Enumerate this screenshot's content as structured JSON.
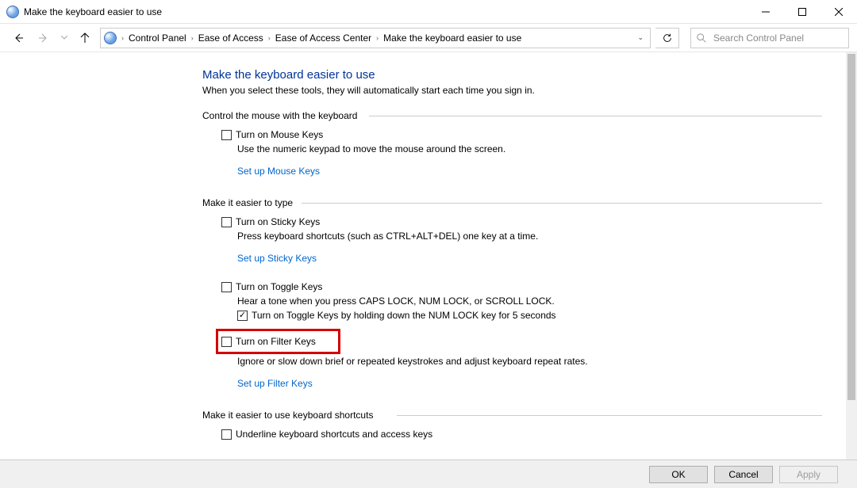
{
  "window": {
    "title": "Make the keyboard easier to use"
  },
  "breadcrumb": {
    "items": [
      "Control Panel",
      "Ease of Access",
      "Ease of Access Center",
      "Make the keyboard easier to use"
    ]
  },
  "search": {
    "placeholder": "Search Control Panel"
  },
  "page": {
    "heading": "Make the keyboard easier to use",
    "subheading": "When you select these tools, they will automatically start each time you sign in."
  },
  "sections": {
    "mouse": {
      "title": "Control the mouse with the keyboard",
      "mouse_keys_label": "Turn on Mouse Keys",
      "mouse_keys_desc": "Use the numeric keypad to move the mouse around the screen.",
      "setup_link": "Set up Mouse Keys"
    },
    "type": {
      "title": "Make it easier to type",
      "sticky_label": "Turn on Sticky Keys",
      "sticky_desc": "Press keyboard shortcuts (such as CTRL+ALT+DEL) one key at a time.",
      "sticky_link": "Set up Sticky Keys",
      "toggle_label": "Turn on Toggle Keys",
      "toggle_desc": "Hear a tone when you press CAPS LOCK, NUM LOCK, or SCROLL LOCK.",
      "toggle_hold_label": "Turn on Toggle Keys by holding down the NUM LOCK key for 5 seconds",
      "filter_label": "Turn on Filter Keys",
      "filter_desc": "Ignore or slow down brief or repeated keystrokes and adjust keyboard repeat rates.",
      "filter_link": "Set up Filter Keys"
    },
    "shortcuts": {
      "title": "Make it easier to use keyboard shortcuts",
      "underline_label": "Underline keyboard shortcuts and access keys"
    }
  },
  "buttons": {
    "ok": "OK",
    "cancel": "Cancel",
    "apply": "Apply"
  }
}
